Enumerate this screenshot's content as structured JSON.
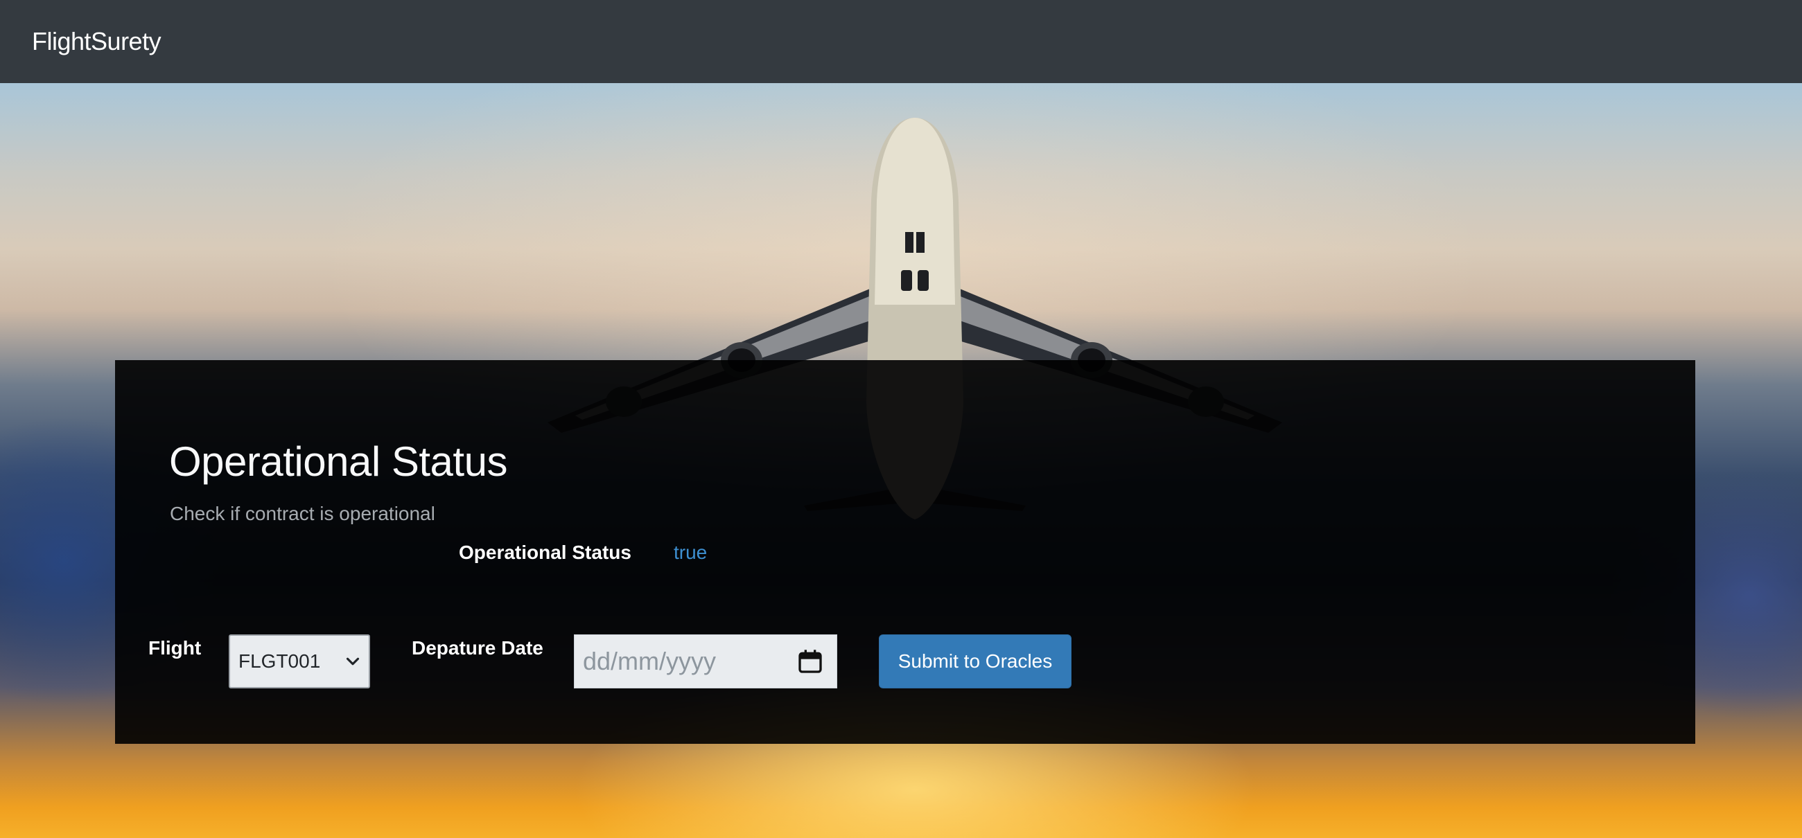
{
  "navbar": {
    "brand": "FlightSurety"
  },
  "status_panel": {
    "title": "Operational Status",
    "subtitle": "Check if contract is operational",
    "status_label": "Operational Status",
    "status_value": "true"
  },
  "form": {
    "flight_label": "Flight",
    "flight_selected": "FLGT001",
    "date_label": "Depature Date",
    "date_placeholder": "dd/mm/yyyy",
    "submit_label": "Submit to Oracles"
  },
  "colors": {
    "navbar_bg": "#343a40",
    "panel_bg": "#000000",
    "status_value": "#3d8fd1",
    "button_bg": "#337ab7"
  },
  "icons": {
    "select_arrow": "chevron-down-icon",
    "date_picker": "calendar-icon"
  }
}
